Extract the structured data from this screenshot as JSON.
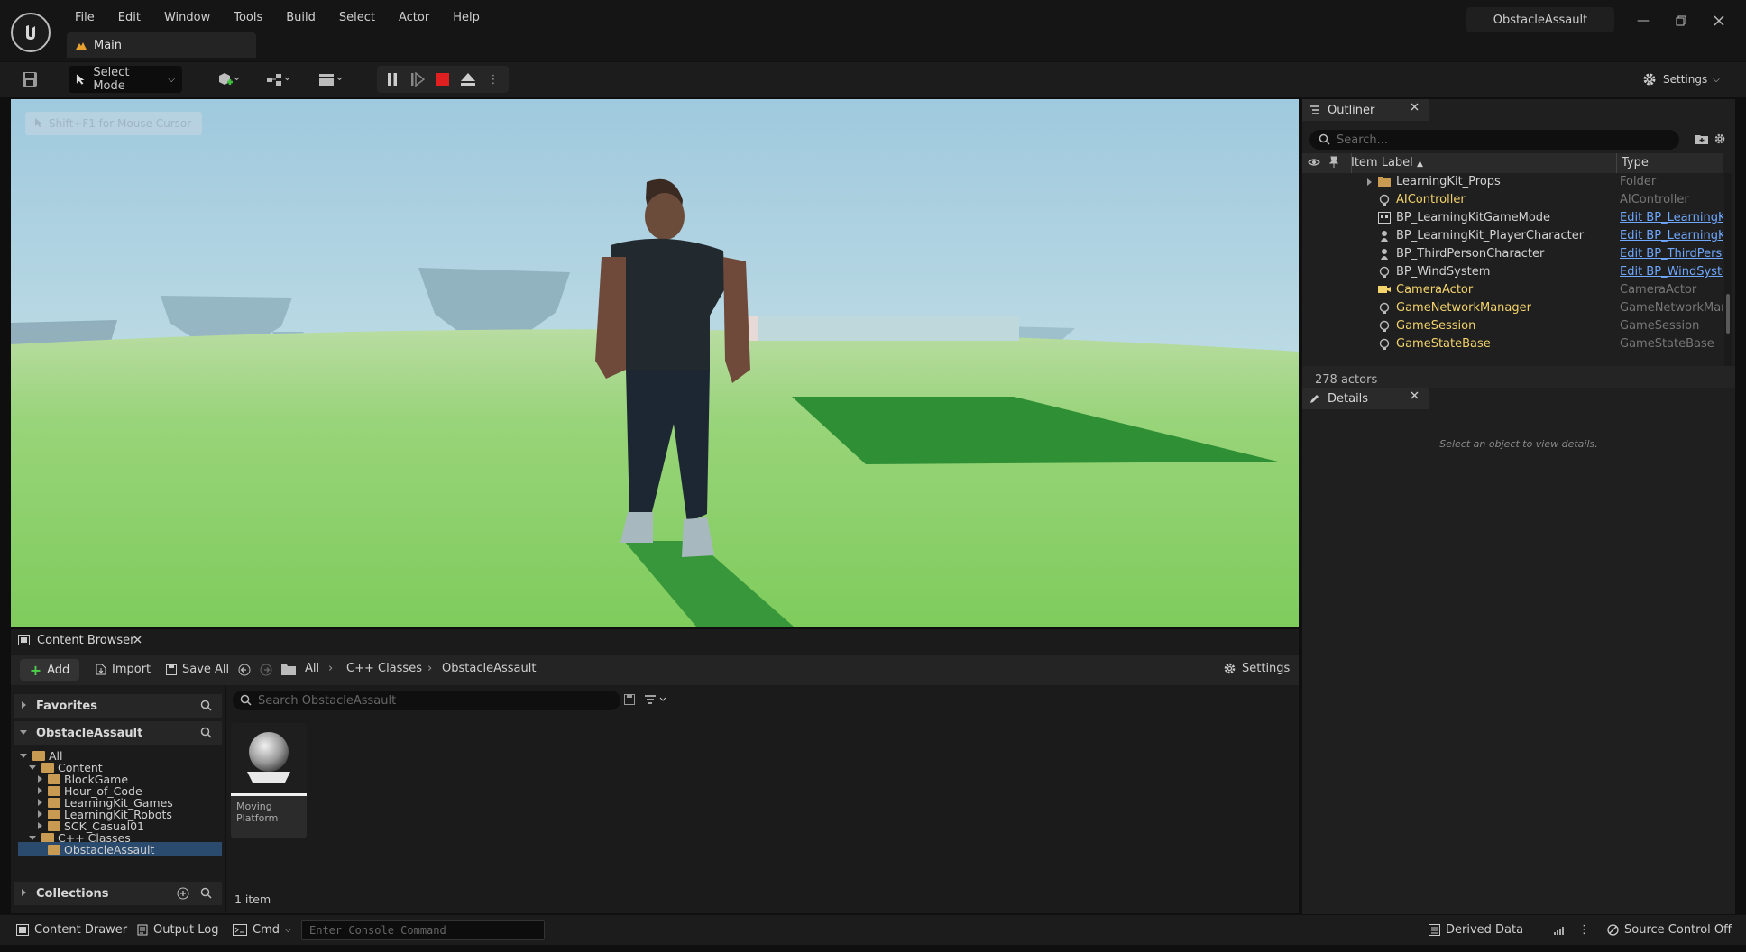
{
  "menu": [
    "File",
    "Edit",
    "Window",
    "Tools",
    "Build",
    "Select",
    "Actor",
    "Help"
  ],
  "level_tab": "Main",
  "project_name": "ObstacleAssault",
  "toolbar": {
    "select_mode": "Select Mode",
    "settings": "Settings"
  },
  "viewport": {
    "mouse_hint": "Shift+F1 for Mouse Cursor"
  },
  "outliner": {
    "tab": "Outliner",
    "search_placeholder": "Search...",
    "col_label": "Item Label",
    "col_type": "Type",
    "rows": [
      {
        "label": "LearningKit_Props",
        "type": "Folder",
        "icon": "folder-icon",
        "link": false
      },
      {
        "label": "AIController",
        "type": "AIController",
        "icon": "actor-icon",
        "link": false
      },
      {
        "label": "BP_LearningKitGameMode",
        "type": "Edit BP_LearningKit",
        "icon": "blueprint-icon",
        "link": true
      },
      {
        "label": "BP_LearningKit_PlayerCharacter",
        "type": "Edit BP_LearningKi",
        "icon": "pawn-icon",
        "link": true
      },
      {
        "label": "BP_ThirdPersonCharacter",
        "type": "Edit BP_ThirdPerso",
        "icon": "pawn-icon",
        "link": true
      },
      {
        "label": "BP_WindSystem",
        "type": "Edit BP_WindSystem",
        "icon": "actor-icon",
        "link": true
      },
      {
        "label": "CameraActor",
        "type": "CameraActor",
        "icon": "camera-icon",
        "link": false
      },
      {
        "label": "GameNetworkManager",
        "type": "GameNetworkMana",
        "icon": "actor-icon",
        "link": false
      },
      {
        "label": "GameSession",
        "type": "GameSession",
        "icon": "actor-icon",
        "link": false
      },
      {
        "label": "GameStateBase",
        "type": "GameStateBase",
        "icon": "actor-icon",
        "link": false
      }
    ],
    "actor_count": "278 actors"
  },
  "details": {
    "tab": "Details",
    "empty_text": "Select an object to view details."
  },
  "content_browser": {
    "tab": "Content Browser",
    "add": "Add",
    "import": "Import",
    "save_all": "Save All",
    "breadcrumbs": [
      "All",
      "C++ Classes",
      "ObstacleAssault"
    ],
    "settings": "Settings",
    "favorites": "Favorites",
    "project": "ObstacleAssault",
    "collections": "Collections",
    "tree": [
      {
        "label": "All",
        "depth": 0,
        "expanded": true
      },
      {
        "label": "Content",
        "depth": 1,
        "expanded": true
      },
      {
        "label": "BlockGame",
        "depth": 2,
        "expanded": false
      },
      {
        "label": "Hour_of_Code",
        "depth": 2,
        "expanded": false
      },
      {
        "label": "LearningKit_Games",
        "depth": 2,
        "expanded": false
      },
      {
        "label": "LearningKit_Robots",
        "depth": 2,
        "expanded": false
      },
      {
        "label": "SCK_Casual01",
        "depth": 2,
        "expanded": false
      },
      {
        "label": "C++ Classes",
        "depth": 1,
        "expanded": true
      },
      {
        "label": "ObstacleAssault",
        "depth": 2,
        "expanded": false,
        "selected": true
      }
    ],
    "search_placeholder": "Search ObstacleAssault",
    "asset": {
      "line1": "Moving",
      "line2": "Platform"
    },
    "item_count": "1 item"
  },
  "statusbar": {
    "content_drawer": "Content Drawer",
    "output_log": "Output Log",
    "cmd": "Cmd",
    "console_placeholder": "Enter Console Command",
    "derived_data": "Derived Data",
    "source_control": "Source Control Off"
  }
}
